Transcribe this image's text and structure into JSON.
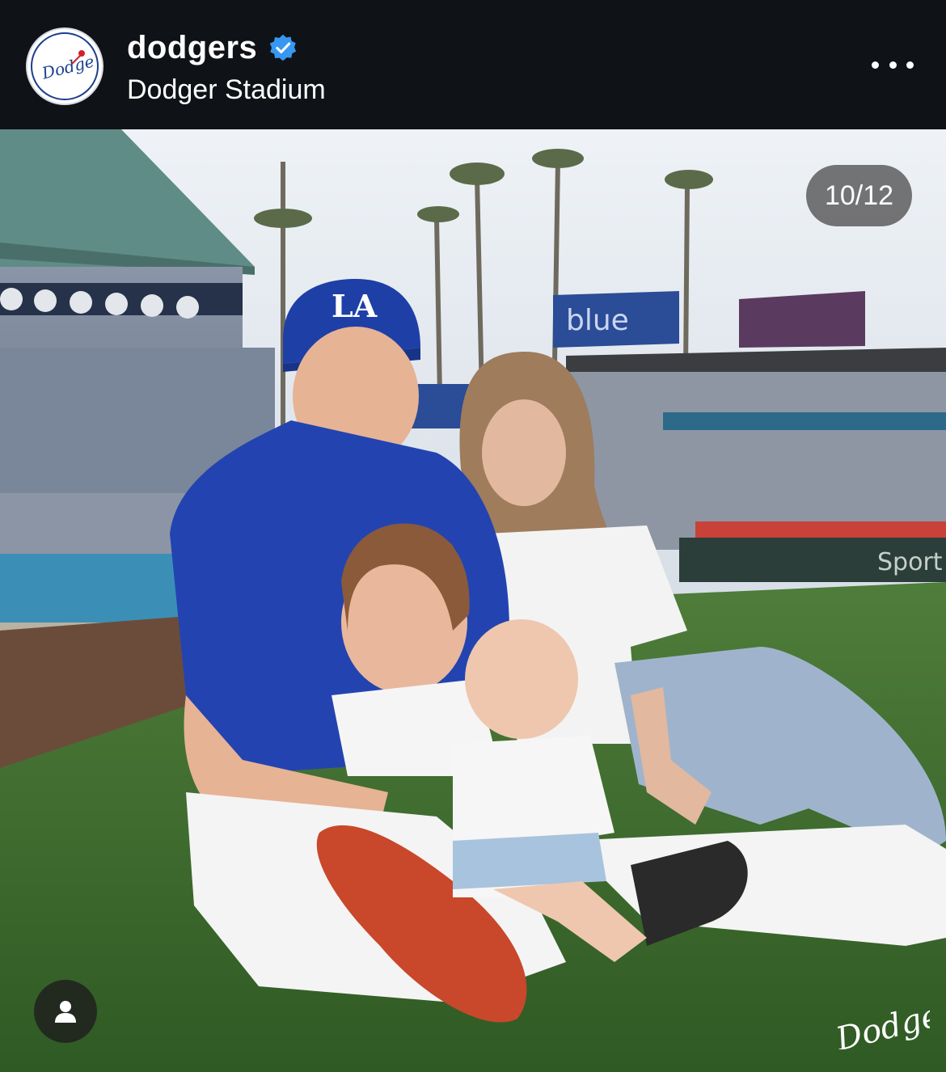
{
  "header": {
    "username": "dodgers",
    "location": "Dodger Stadium",
    "avatar_icon": "dodgers-logo-icon",
    "verified_icon": "verified-badge-icon",
    "more_icon": "more-options-icon"
  },
  "media": {
    "counter": "10/12",
    "tag_icon": "user-tag-icon",
    "watermark": "Dodgers"
  },
  "colors": {
    "header_bg": "#0f1216",
    "verified_blue": "#3897f0",
    "dodger_blue": "#1e3fa6",
    "counter_bg": "#505050"
  }
}
